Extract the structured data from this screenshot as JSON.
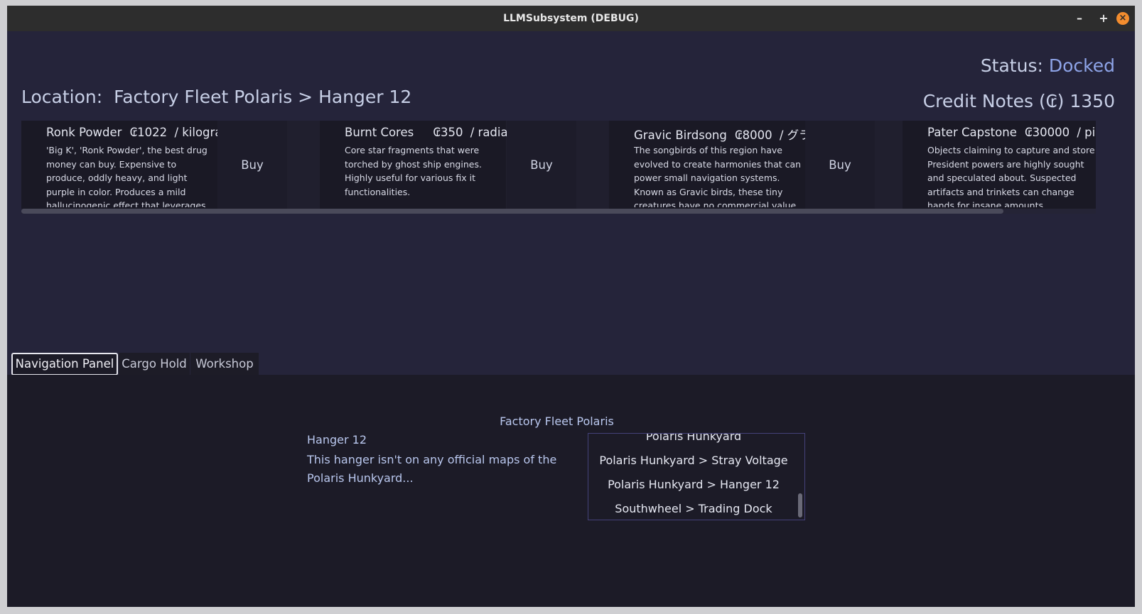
{
  "window": {
    "title": "LLMSubsystem (DEBUG)",
    "min_label": "–",
    "max_label": "+",
    "close_label": "×"
  },
  "header": {
    "status_label": "Status:",
    "status_value": "Docked",
    "location_label": "Location:",
    "location_value": "Factory Fleet Polaris > Hanger 12",
    "credits_label": "Credit Notes (₢)",
    "credits_value": "1350"
  },
  "goods": [
    {
      "name": "Ronk Powder",
      "price": "₢1022",
      "unit": "/ kilogram",
      "description": "'Big K', 'Ronk Powder', the best drug money can buy. Expensive to produce, oddly heavy, and light purple in color. Produces a mild hallucinogenic effect that leverages the local electo-",
      "buy_label": "Buy"
    },
    {
      "name": "Burnt Cores",
      "price": "₢350",
      "unit": "/ radians",
      "description": "Core star fragments that were torched by ghost ship engines. Highly useful for various fix it functionalities.",
      "buy_label": "Buy"
    },
    {
      "name": "Gravic Birdsong",
      "price": "₢8000",
      "unit": "/ グラム",
      "description": "The songbirds of this region have evolved to create harmonies that can power small navigation systems. Known as Gravic birds, these tiny creatures have no commercial value to standard species-",
      "buy_label": "Buy"
    },
    {
      "name": "Pater Capstone",
      "price": "₢30000",
      "unit": "/ piece",
      "description": "Objects claiming to capture and store President powers are highly sought and speculated about. Suspected artifacts and trinkets can change hands for insane amounts.",
      "buy_label": "Buy"
    }
  ],
  "tabs": [
    {
      "label": "Navigation Panel",
      "active": true
    },
    {
      "label": "Cargo Hold",
      "active": false
    },
    {
      "label": "Workshop",
      "active": false
    }
  ],
  "navigation": {
    "system_name": "Factory Fleet Polaris",
    "destination_name": "Hanger 12",
    "destination_description": "This hanger isn't on any official maps of the Polaris Hunkyard...",
    "routes": [
      "Polaris Hunkyard",
      "Polaris Hunkyard > Stray Voltage",
      "Polaris Hunkyard > Hanger 12",
      "Southwheel > Trading Dock"
    ]
  },
  "colors": {
    "status_value": "#8ea4e8",
    "close_button": "#f38d2e",
    "panel_bg": "#25243a",
    "app_bg": "#1c1b27"
  }
}
